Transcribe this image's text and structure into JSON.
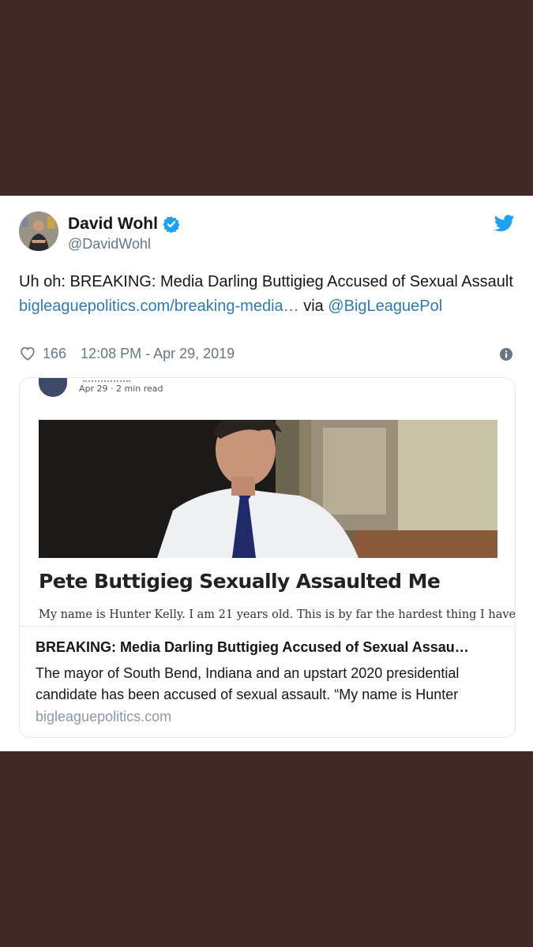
{
  "tweet": {
    "author": {
      "name": "David Wohl",
      "handle": "@DavidWohl"
    },
    "text_parts": {
      "prefix": "Uh oh: BREAKING: Media Darling Buttigieg Accused of Sexual Assault ",
      "link": "bigleaguepolitics.com/breaking-media…",
      "middle": " via ",
      "mention": "@BigLeaguePol"
    },
    "likes": "166",
    "timestamp": "12:08 PM - Apr 29, 2019"
  },
  "card": {
    "screenshot": {
      "date_meta": "Apr 29 · 2 min read",
      "headline": "Pete Buttigieg Sexually Assaulted Me",
      "excerpt": "My name is Hunter Kelly. I am 21 years old. This is by far the hardest thing I have"
    },
    "title": "BREAKING: Media Darling Buttigieg Accused of Sexual Assau…",
    "description": "The mayor of South Bend, Indiana and an upstart 2020 presidential candidate has been accused of sexual assault. “My name is Hunter",
    "domain": "bigleaguepolitics.com"
  },
  "colors": {
    "background": "#3f2b28",
    "link": "#2b7bb9",
    "twitter_blue": "#1da1f2",
    "muted": "#657786"
  },
  "icons": [
    "verified-badge-icon",
    "twitter-bird-icon",
    "heart-icon",
    "info-icon"
  ]
}
